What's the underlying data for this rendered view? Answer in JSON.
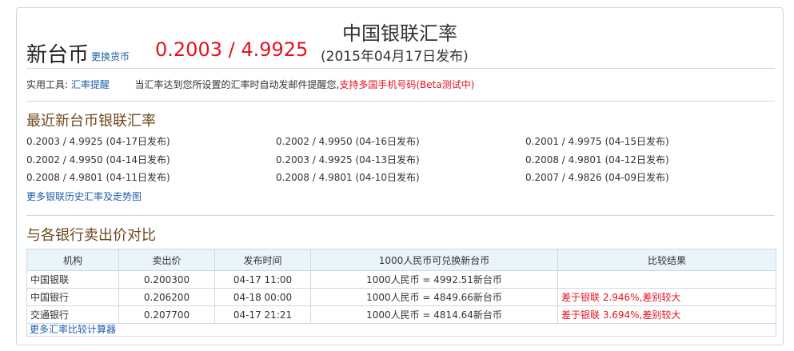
{
  "header": {
    "title": "中国银联汇率",
    "currency": "新台币",
    "switch_label": "更换货币",
    "rate": "0.2003 / 4.9925",
    "publish_date": "(2015年04月17日发布)"
  },
  "tools": {
    "label": "实用工具:",
    "link": "汇率提醒",
    "desc": "当汇率达到您所设置的汇率时自动发邮件提醒您,",
    "highlight": "支持多国手机号码(Beta测试中)"
  },
  "recent": {
    "title": "最近新台币银联汇率",
    "rows": [
      [
        "0.2003 / 4.9925  (04-17日发布)",
        "0.2002 / 4.9950  (04-16日发布)",
        "0.2001 / 4.9975  (04-15日发布)"
      ],
      [
        "0.2002 / 4.9950  (04-14日发布)",
        "0.2003 / 4.9925  (04-13日发布)",
        "0.2008 / 4.9801  (04-12日发布)"
      ],
      [
        "0.2008 / 4.9801  (04-11日发布)",
        "0.2008 / 4.9801  (04-10日发布)",
        "0.2007 / 4.9826  (04-09日发布)"
      ]
    ],
    "more_link": "更多银联历史汇率及走势图"
  },
  "compare": {
    "title": "与各银行卖出价对比",
    "headers": [
      "机构",
      "卖出价",
      "发布时间",
      "1000人民币可兑换新台币",
      "比较结果"
    ],
    "rows": [
      [
        "中国银联",
        "0.200300",
        "04-17 11:00",
        "1000人民币 = 4992.51新台币",
        ""
      ],
      [
        "中国银行",
        "0.206200",
        "04-18 00:00",
        "1000人民币 = 4849.66新台币",
        "差于银联 2.946%,差别较大"
      ],
      [
        "交通银行",
        "0.207700",
        "04-17 21:21",
        "1000人民币 = 4814.64新台币",
        "差于银联 3.694%,差别较大"
      ]
    ],
    "more_link": "更多汇率比较计算器"
  },
  "colors": {
    "accent_red": "#e4131f",
    "link_blue": "#1a5fa9",
    "section_brown": "#6b4a1e",
    "border": "#c9d9e4",
    "header_bg": "#eaf4fb"
  }
}
